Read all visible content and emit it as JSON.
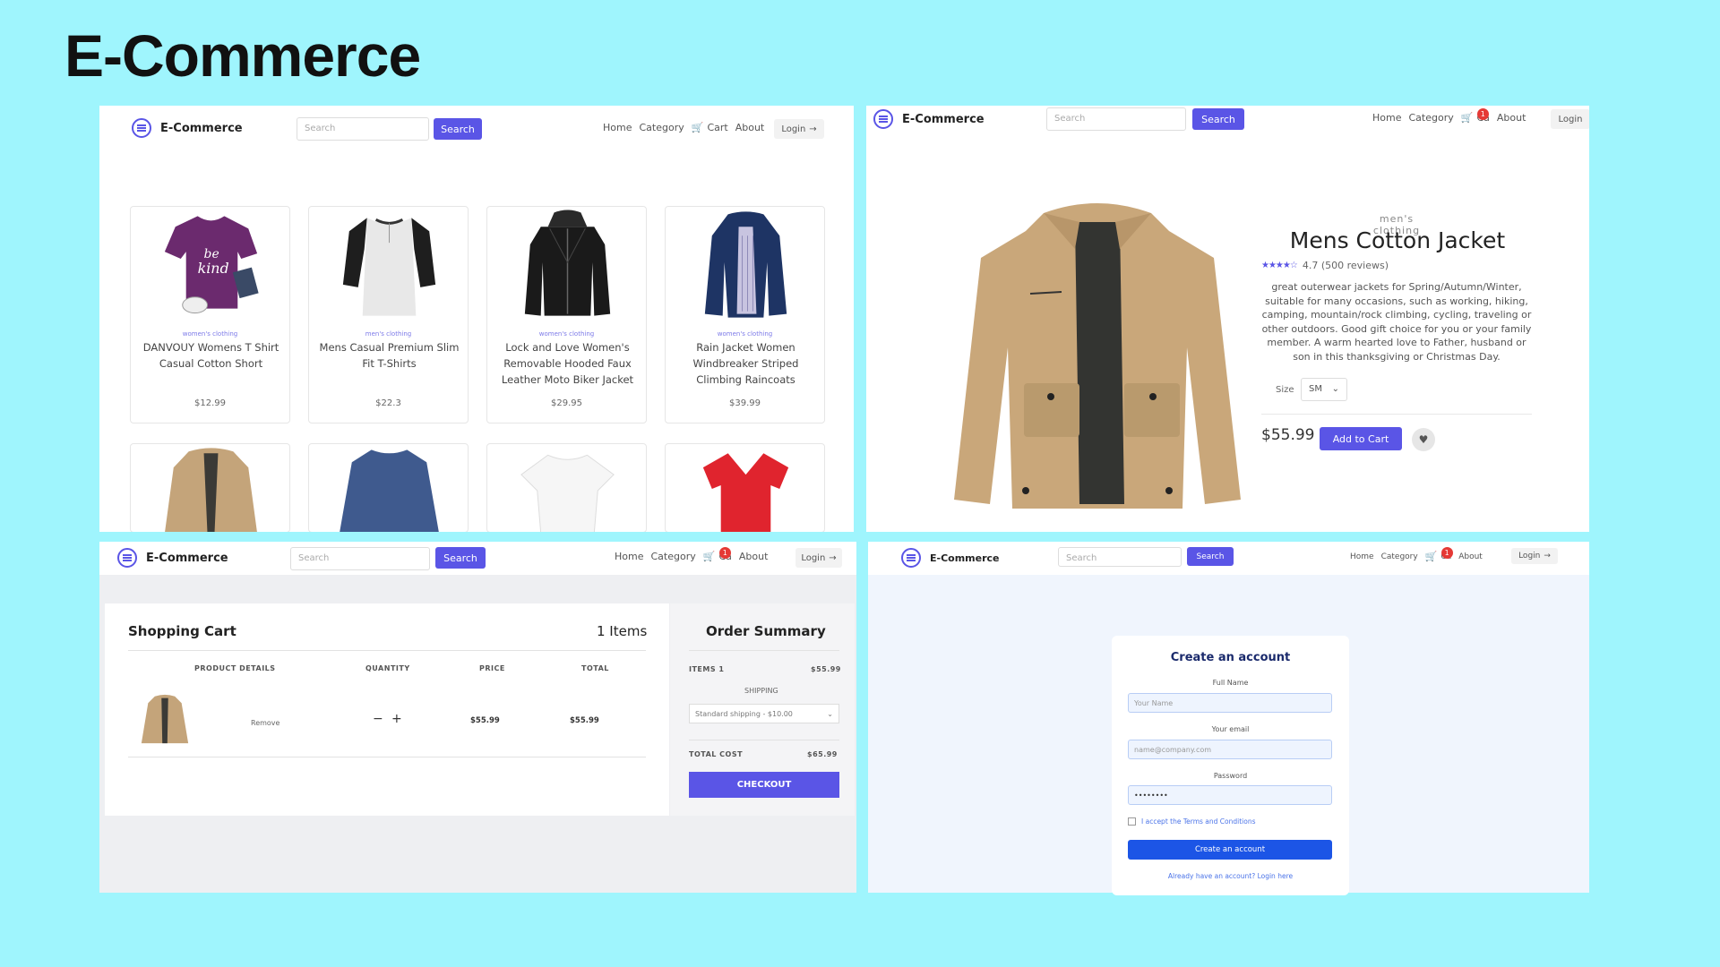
{
  "slide": {
    "title": "E-Commerce"
  },
  "nav": {
    "brand": "E-Commerce",
    "search_placeholder": "Search",
    "search_btn": "Search",
    "links": {
      "home": "Home",
      "category": "Category",
      "cart": "Cart",
      "cart_short": "Ca",
      "about": "About"
    },
    "login": "Login",
    "cart_badge": "1"
  },
  "products": [
    {
      "category": "women's clothing",
      "title": "DANVOUY Womens T Shirt Casual Cotton Short",
      "price": "$12.99",
      "image": "purple-tshirt"
    },
    {
      "category": "men's clothing",
      "title": "Mens Casual Premium Slim Fit T-Shirts",
      "price": "$22.3",
      "image": "raglan-tshirt"
    },
    {
      "category": "women's clothing",
      "title": "Lock and Love Women's Removable Hooded Faux Leather Moto Biker Jacket",
      "price": "$29.95",
      "image": "black-leather-jacket"
    },
    {
      "category": "women's clothing",
      "title": "Rain Jacket Women Windbreaker Striped Climbing Raincoats",
      "price": "$39.99",
      "image": "navy-raincoat"
    }
  ],
  "products_row2": [
    "tan-jacket",
    "blue-longsleeve",
    "white-tshirt",
    "red-tshirt"
  ],
  "detail": {
    "category": "men's clothing",
    "title": "Mens Cotton Jacket",
    "rating": "4.7 (500 reviews)",
    "stars": 4.7,
    "description": "great outerwear jackets for Spring/Autumn/Winter, suitable for many occasions, such as working, hiking, camping, mountain/rock climbing, cycling, traveling or other outdoors. Good gift choice for you or your family member. A warm hearted love to Father, husband or son in this thanksgiving or Christmas Day.",
    "size_label": "Size",
    "size_value": "SM",
    "price": "$55.99",
    "add_to_cart": "Add to Cart"
  },
  "cart": {
    "title": "Shopping Cart",
    "items_count": "1 Items",
    "headers": {
      "product": "PRODUCT DETAILS",
      "quantity": "QUANTITY",
      "price": "PRICE",
      "total": "TOTAL"
    },
    "row": {
      "remove": "Remove",
      "minus": "−",
      "plus": "+",
      "price": "$55.99",
      "total": "$55.99"
    },
    "summary": {
      "title": "Order Summary",
      "items_label": "ITEMS 1",
      "items_value": "$55.99",
      "shipping_label": "SHIPPING",
      "shipping_option": "Standard shipping - $10.00",
      "total_label": "TOTAL COST",
      "total_value": "$65.99",
      "checkout": "CHECKOUT"
    }
  },
  "signup": {
    "title": "Create an account",
    "full_name_label": "Full Name",
    "full_name_placeholder": "Your Name",
    "email_label": "Your email",
    "email_placeholder": "name@company.com",
    "password_label": "Password",
    "password_value": "••••••••",
    "terms": "I accept the Terms and Conditions",
    "button": "Create an account",
    "footer": "Already have an account? Login here"
  },
  "colors": {
    "background": "#9ff5fd",
    "accent": "#5a55e6",
    "signup_button": "#1c55e6",
    "badge": "#e53935"
  }
}
